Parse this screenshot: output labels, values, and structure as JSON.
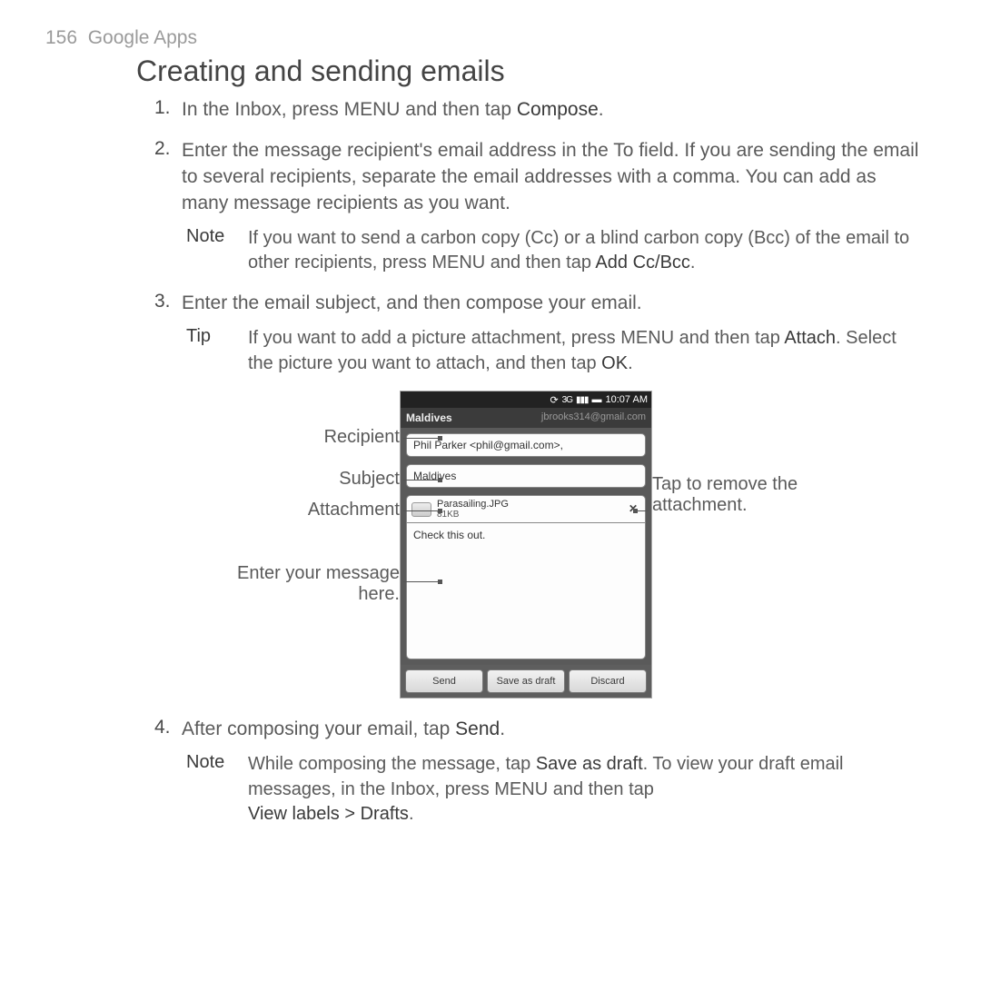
{
  "header": {
    "page_num": "156",
    "running_head": "Google Apps"
  },
  "title": "Creating and sending emails",
  "steps": {
    "s1": {
      "num": "1.",
      "text_a": "In the Inbox, press MENU and then tap ",
      "kw": "Compose",
      "text_b": "."
    },
    "s2": {
      "num": "2.",
      "text": "Enter the message recipient's email address in the To field. If you are sending the email to several recipients, separate the email addresses with a comma. You can add as many message recipients as you want."
    },
    "s2_note": {
      "label": "Note",
      "text_a": "If you want to send a carbon copy (Cc) or a blind carbon copy (Bcc) of the email to other recipients, press MENU and then tap ",
      "kw": "Add Cc/Bcc",
      "text_b": "."
    },
    "s3": {
      "num": "3.",
      "text": "Enter the email subject, and then compose your email."
    },
    "s3_tip": {
      "label": "Tip",
      "text_a": "If you want to add a picture attachment, press MENU and then tap ",
      "kw1": "Attach",
      "text_b": ". Select the picture you want to attach, and then tap ",
      "kw2": "OK",
      "text_c": "."
    },
    "s4": {
      "num": "4.",
      "text_a": "After composing your email, tap ",
      "kw": "Send",
      "text_b": "."
    },
    "s4_note": {
      "label": "Note",
      "text_a": "While composing the message, tap ",
      "kw1": "Save as draft",
      "text_b": ". To view your draft email messages, in the Inbox, press MENU and then tap ",
      "kw2": "View labels > Drafts",
      "text_c": "."
    }
  },
  "callouts": {
    "recipient": "Recipient",
    "subject": "Subject",
    "attachment": "Attachment",
    "message": "Enter your message here.",
    "remove": "Tap to remove the attachment."
  },
  "phone": {
    "time": "10:07 AM",
    "title_left": "Maldives",
    "title_right": "jbrooks314@gmail.com",
    "to_field": "Phil Parker <phil@gmail.com>,",
    "subject_field": "Maldives",
    "attach_name": "Parasailing.JPG",
    "attach_size": "81KB",
    "remove_x": "✕",
    "body_text": "Check this out.",
    "btn_send": "Send",
    "btn_save": "Save as draft",
    "btn_discard": "Discard"
  }
}
